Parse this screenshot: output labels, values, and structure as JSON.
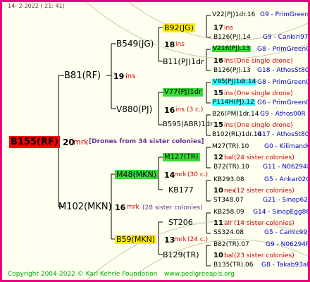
{
  "header": {
    "date": "14-  2-2022 (  21: 41)"
  },
  "root": {
    "id": "B155(RF)",
    "count": "20",
    "unit": "mrk",
    "note": "[Drones from 34 sister colonies]"
  },
  "g1": [
    {
      "id": "B81(RF)",
      "count": "19",
      "unit": "ins"
    },
    {
      "id": "M102(MKN)",
      "count": "16",
      "unit": "mrk",
      "note": "(28 sister colonies)"
    }
  ],
  "g2": [
    {
      "id": "B549(JG)"
    },
    {
      "id": "V880(PJ)",
      "count": "16",
      "unit": "ins",
      "note": "(3 c.)"
    },
    {
      "id": "M48(MKN)",
      "count": "14",
      "unit": "mrk",
      "note": "(30 c.)"
    },
    {
      "id": "B59(MKN)",
      "count": "13",
      "unit": "mrk",
      "note": "(24 c.)"
    }
  ],
  "g3": [
    {
      "id": "B92(JG)",
      "count": "18",
      "unit": "ins"
    },
    {
      "id": "B11(PJ)1dr"
    },
    {
      "id": "V77(PJ)1dr",
      "count": "15",
      "unit": "ins"
    },
    {
      "id": "B595(ABR)1dr"
    },
    {
      "id": "M127(TR)",
      "count": "12",
      "unit": "bal",
      "note": "(24 sister colonies)"
    },
    {
      "id": "KB177"
    },
    {
      "id": "ST206",
      "count": "11",
      "unit": "alr",
      "note": "(14 sister colonies)"
    },
    {
      "id": "B129(TR)"
    }
  ],
  "g4": [
    {
      "id": "V22(PJ)1dr.16",
      "code": "G9 - PrimGreen00"
    },
    {
      "id": "B126(PJ).14",
      "code": "G9 - Cankiri97Q"
    },
    {
      "id": "V216(PJ).13",
      "code": "G8 - PrimGreen00"
    },
    {
      "id": "B126(PJ).13",
      "code": "G18 - AthosSt80R"
    },
    {
      "id": "V95(PJ)1dr.14",
      "code": "G8 - PrimGreen00"
    },
    {
      "id": "P114H(PJ).12",
      "code": "G6 - PrimGreen00"
    },
    {
      "id": "B26(PM)1dr.14",
      "code": "G9 - Athos00R"
    },
    {
      "id": "B102(RL)1dr.14",
      "code": "G17 - AthosSt80R"
    },
    {
      "id": "M27(TR).10",
      "code": "G0 - KilimandQ"
    },
    {
      "id": "B72(TR).10",
      "code": "G11 - N06294R"
    },
    {
      "id": "KB293.08",
      "code": "G5 - Ankar02Q"
    },
    {
      "id": "ST348.07",
      "code": "G21 - Sinop62R"
    },
    {
      "id": "KB258.09",
      "code": "G14 - SinopEgg86R"
    },
    {
      "id": "SS324.08",
      "code": "G5 - Camic99R"
    },
    {
      "id": "B82(TR).07",
      "code": "G9 - N06294R"
    },
    {
      "id": "B135(TR).06",
      "code": "G8 - Takab93aR"
    }
  ],
  "drone_notes": {
    "b92_count": "17",
    "b92_unit": "ins",
    "b11_count": "16",
    "b11_unit": "ins",
    "b11_note": "(One single drone)",
    "v77_count": "15",
    "v77_unit": "ins",
    "v77_note": "(One single drone)",
    "b595_count": "15",
    "b595_unit": "ins",
    "b595_note": "(One single drone)",
    "m127_count": "12",
    "m127_unit": "bal",
    "m127_note": "(24 sister colonies)",
    "kb177_count": "10",
    "kb177_unit": "nex",
    "kb177_note": "(12 sister colonies)",
    "st206_count": "11",
    "st206_unit": "alr",
    "st206_note": "(14 sister colonies)",
    "b129_count": "10",
    "b129_unit": "bal",
    "b129_note": "(23 sister colonies)"
  },
  "footer": {
    "copyright": "Copyright 2004-2022 © Karl Kehrle Foundation",
    "site": "www.pedigreeapis.org"
  },
  "colors": {
    "border": "#e8007a",
    "bg": "#fffff0",
    "green": "#33dd33",
    "yellow": "#ffee00",
    "cyan": "#33ffff",
    "root": "#ff0000"
  }
}
